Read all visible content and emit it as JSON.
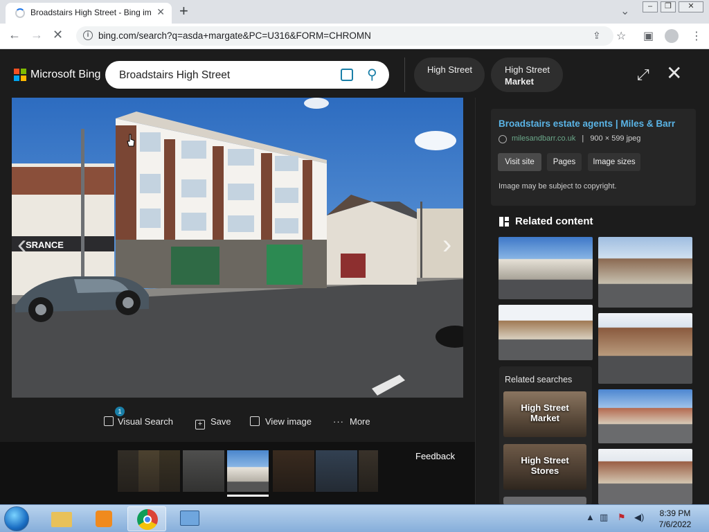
{
  "browser": {
    "tab_title": "Broadstairs High Street - Bing im",
    "new_tab": "+",
    "url": "bing.com/search?q=asda+margate&PC=U316&FORM=CHROMN",
    "window_controls": {
      "minimize": "–",
      "restore": "❐",
      "close": "✕"
    }
  },
  "bing": {
    "logo_text": "Microsoft Bing",
    "search_query": "Broadstairs High Street",
    "pills": [
      {
        "line1": "High Street",
        "line2": ""
      },
      {
        "line1": "High Street",
        "line2": "Market"
      }
    ]
  },
  "actions": {
    "visual_search": "Visual Search",
    "visual_search_badge": "1",
    "save": "Save",
    "view_image": "View image",
    "more": "More"
  },
  "filmstrip": {
    "feedback": "Feedback"
  },
  "detail": {
    "title": "Broadstairs estate agents | Miles & Barr",
    "domain": "milesandbarr.co.uk",
    "separator": "|",
    "size": "900 × 599 jpeg",
    "buttons": [
      "Visit site",
      "Pages",
      "Image sizes"
    ],
    "copyright": "Image may be subject to copyright."
  },
  "related": {
    "heading": "Related content",
    "searches_title": "Related searches",
    "searches": [
      {
        "line1": "High Street",
        "line2": "Market"
      },
      {
        "line1": "High Street",
        "line2": "Stores"
      }
    ]
  },
  "taskbar": {
    "time": "8:39 PM",
    "date": "7/6/2022"
  },
  "colors": {
    "bing_bg": "#1c1c1c",
    "link_blue": "#5ab4e6",
    "domain_green": "#6ba88a",
    "accent": "#1a7fa8"
  }
}
